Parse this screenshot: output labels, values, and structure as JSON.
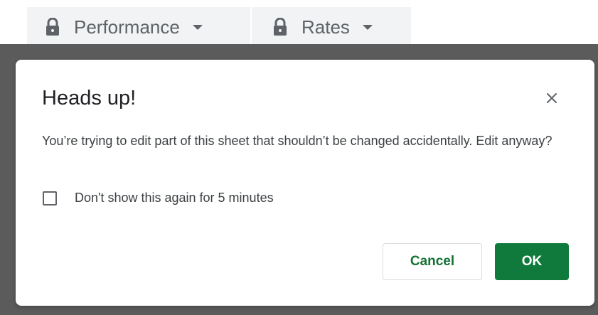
{
  "sheet_tabs": [
    {
      "label": "Performance",
      "icon": "lock-icon",
      "menu_icon": "caret-down-icon"
    },
    {
      "label": "Rates",
      "icon": "lock-icon",
      "menu_icon": "caret-down-icon"
    }
  ],
  "dialog": {
    "title": "Heads up!",
    "close_icon": "close-icon",
    "message": "You’re trying to edit part of this sheet that shouldn’t be changed accidentally. Edit anyway?",
    "checkbox_label": "Don't show this again for 5 minutes",
    "checkbox_checked": false,
    "cancel_label": "Cancel",
    "ok_label": "OK"
  },
  "colors": {
    "primary_green": "#0f7a3c",
    "cancel_text": "#137333",
    "scrim": "#5b5b5b",
    "tab_background": "#f1f3f4"
  }
}
